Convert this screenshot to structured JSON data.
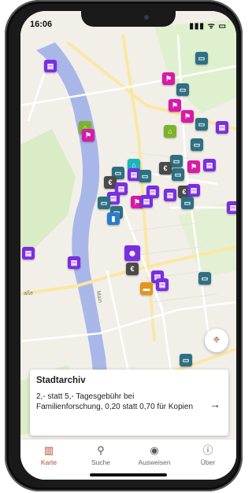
{
  "status_bar": {
    "time": "16:06",
    "icons": "▮▮▮ ᯤ ▭"
  },
  "map": {
    "street_label_left": "aße",
    "river_label": "Main"
  },
  "pins": [
    {
      "name": "pin-1",
      "color": "purple",
      "glyph": "▤"
    },
    {
      "name": "pin-2",
      "color": "teal",
      "glyph": "▭"
    },
    {
      "name": "pin-3",
      "color": "magenta",
      "glyph": "⚑"
    }
  ],
  "detail_card": {
    "title": "Stadtarchiv",
    "body": "2,- statt 5,- Tagesgebühr bei Familienforschung, 0,20 statt 0,70 für Kopien",
    "arrow": "→"
  },
  "tabs": [
    {
      "label": "Karte",
      "icon": "map-icon",
      "glyph": "▥"
    },
    {
      "label": "Suche",
      "icon": "search-icon",
      "glyph": "⚲"
    },
    {
      "label": "Ausweisen",
      "icon": "eye-icon",
      "glyph": "◉"
    },
    {
      "label": "Über",
      "icon": "info-icon",
      "glyph": "ⓘ"
    }
  ],
  "colors": {
    "accent": "#b14a2d",
    "purple": "#7a2ee0",
    "magenta": "#d91aa8",
    "teal": "#2f6f82",
    "river": "#a9b7e8"
  }
}
